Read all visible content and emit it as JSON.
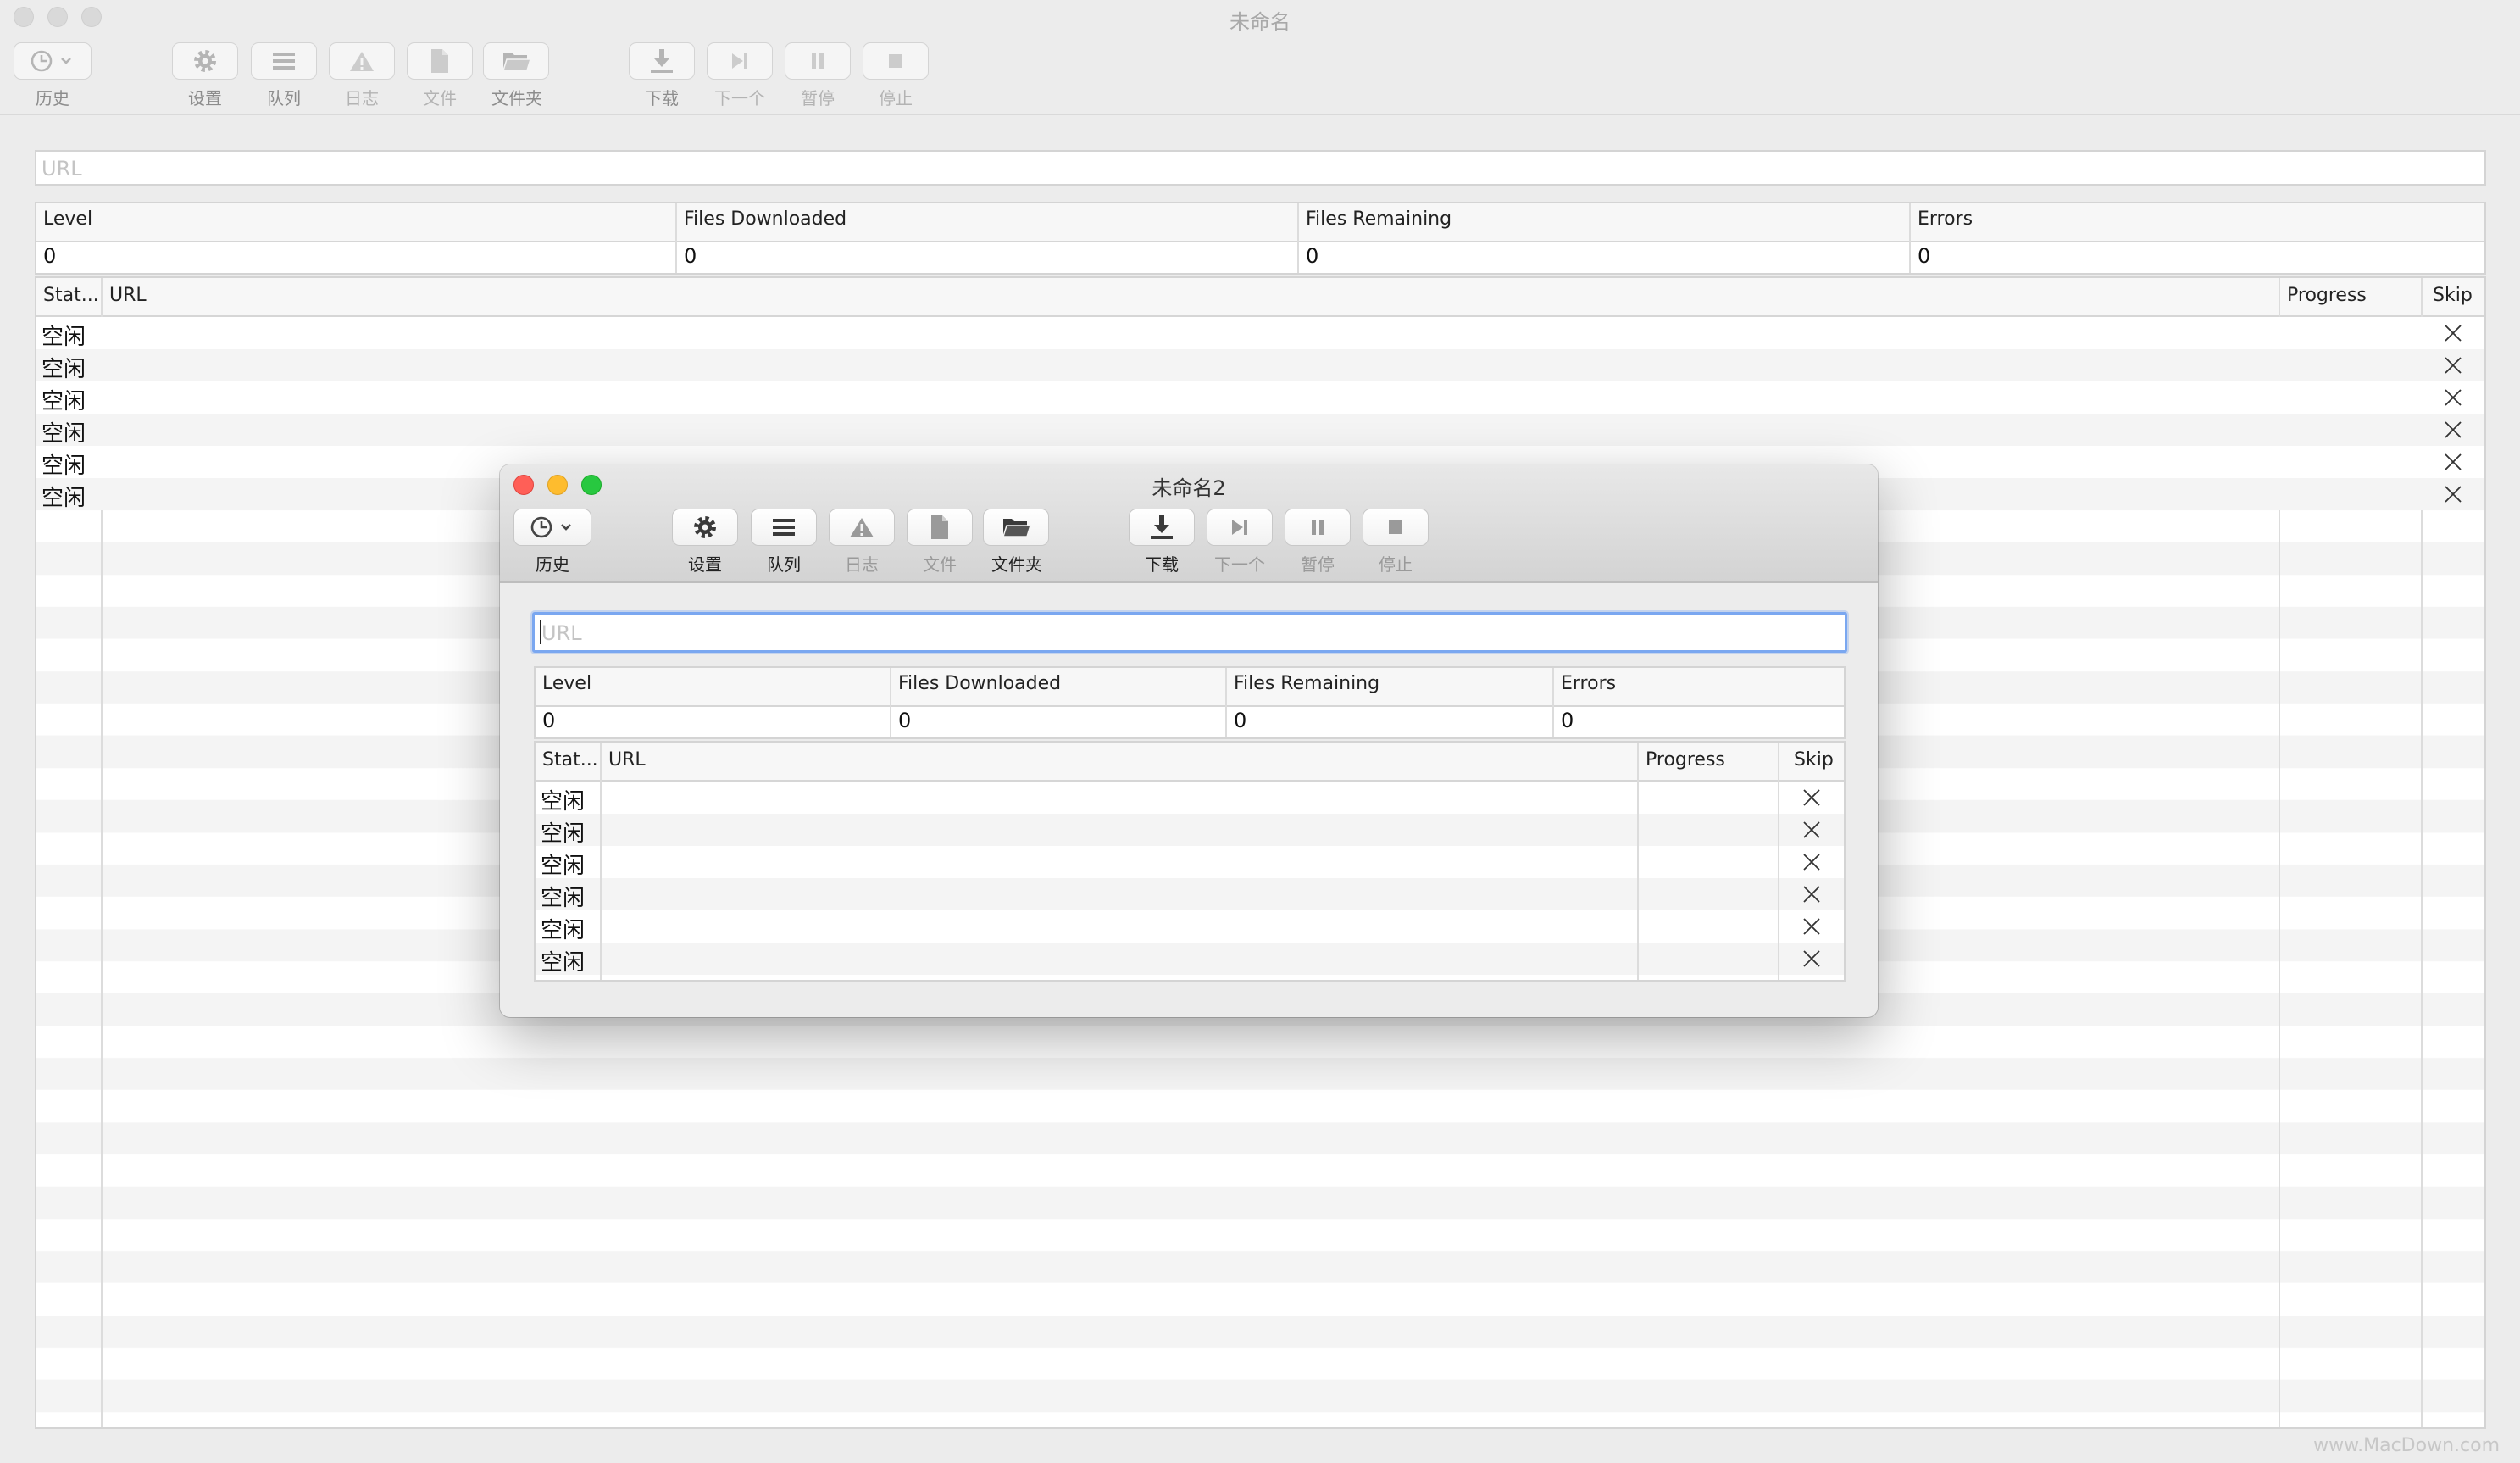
{
  "windows": {
    "background": {
      "title": "未命名"
    },
    "foreground": {
      "title": "未命名2"
    }
  },
  "toolbar": {
    "history": "历史",
    "settings": "设置",
    "queue": "队列",
    "log": "日志",
    "file": "文件",
    "folder": "文件夹",
    "download": "下载",
    "next": "下一个",
    "pause": "暂停",
    "stop": "停止"
  },
  "url_field": {
    "placeholder": "URL"
  },
  "stats": {
    "headers": [
      "Level",
      "Files Downloaded",
      "Files Remaining",
      "Errors"
    ],
    "values": [
      "0",
      "0",
      "0",
      "0"
    ]
  },
  "queue_table": {
    "headers": {
      "status": "Stat...",
      "url": "URL",
      "progress": "Progress",
      "skip": "Skip"
    },
    "rows": [
      {
        "status": "空闲",
        "url": "",
        "progress": ""
      },
      {
        "status": "空闲",
        "url": "",
        "progress": ""
      },
      {
        "status": "空闲",
        "url": "",
        "progress": ""
      },
      {
        "status": "空闲",
        "url": "",
        "progress": ""
      },
      {
        "status": "空闲",
        "url": "",
        "progress": ""
      },
      {
        "status": "空闲",
        "url": "",
        "progress": ""
      }
    ]
  },
  "icons": [
    "clock-icon",
    "chevron-down-icon",
    "gear-icon",
    "list-icon",
    "warning-icon",
    "document-icon",
    "folder-icon",
    "download-icon",
    "skip-forward-icon",
    "pause-icon",
    "stop-icon",
    "close-x-icon"
  ],
  "colors": {
    "close": "#ff5f57",
    "minimize": "#febc2e",
    "zoom": "#28c840",
    "focus_ring": "#7aa7f0"
  },
  "watermark": "www.MacDown.com"
}
